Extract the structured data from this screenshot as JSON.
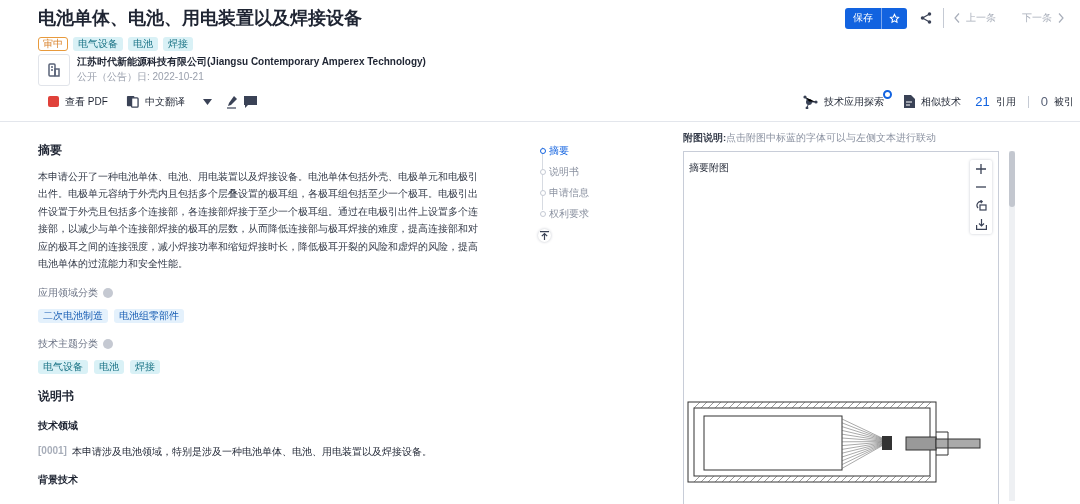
{
  "title": "电池单体、电池、用电装置以及焊接设备",
  "status_tag": "审中",
  "tags": [
    "电气设备",
    "电池",
    "焊接"
  ],
  "applicant": {
    "name": "江苏时代新能源科技有限公司(Jiangsu Contemporary Amperex Technology)",
    "pub_date": "公开（公告）日: 2022-10-21"
  },
  "nav": {
    "save": "保存",
    "prev": "上一条",
    "next": "下一条"
  },
  "toolbar": {
    "pdf": "查看 PDF",
    "translate": "中文翻译",
    "explore": {
      "label": "技术应用探索",
      "badge": true
    },
    "similar": "相似技术",
    "citations": {
      "count": "21",
      "label": "引用"
    },
    "cited_by": {
      "count": "0",
      "label": "被引"
    }
  },
  "abstract": {
    "heading": "摘要",
    "text": "本申请公开了一种电池单体、电池、用电装置以及焊接设备。电池单体包括外壳、电极单元和电极引出件。电极单元容纳于外壳内且包括多个层叠设置的极耳组，各极耳组包括至少一个极耳。电极引出件设置于外壳且包括多个连接部，各连接部焊接于至少一个极耳组。通过在电极引出件上设置多个连接部，以减少与单个连接部焊接的极耳的层数，从而降低连接部与极耳焊接的难度，提高连接部和对应的极耳之间的连接强度，减小焊接功率和缩短焊接时长，降低极耳开裂的风险和虚焊的风险，提高电池单体的过流能力和安全性能。"
  },
  "classifications": [
    {
      "label": "应用领域分类",
      "kind": "domain",
      "tags": [
        "二次电池制造",
        "电池组零部件"
      ]
    },
    {
      "label": "技术主题分类",
      "kind": "topic",
      "tags": [
        "电气设备",
        "电池",
        "焊接"
      ]
    }
  ],
  "description": {
    "heading": "说明书",
    "sections": [
      {
        "heading": "技术领域",
        "paragraphs": [
          {
            "number": "[0001]",
            "text": "本申请涉及电池领域，特别是涉及一种电池单体、电池、用电装置以及焊接设备。"
          }
        ]
      },
      {
        "heading": "背景技术"
      }
    ]
  },
  "toc": [
    {
      "label": "摘要",
      "selected": true
    },
    {
      "label": "说明书",
      "selected": false
    },
    {
      "label": "申请信息",
      "selected": false
    },
    {
      "label": "权利要求",
      "selected": false
    }
  ],
  "figure_panel": {
    "caption_label": "附图说明:",
    "caption": "点击附图中标蓝的字体可以与左侧文本进行联动",
    "title": "摘要附图"
  }
}
